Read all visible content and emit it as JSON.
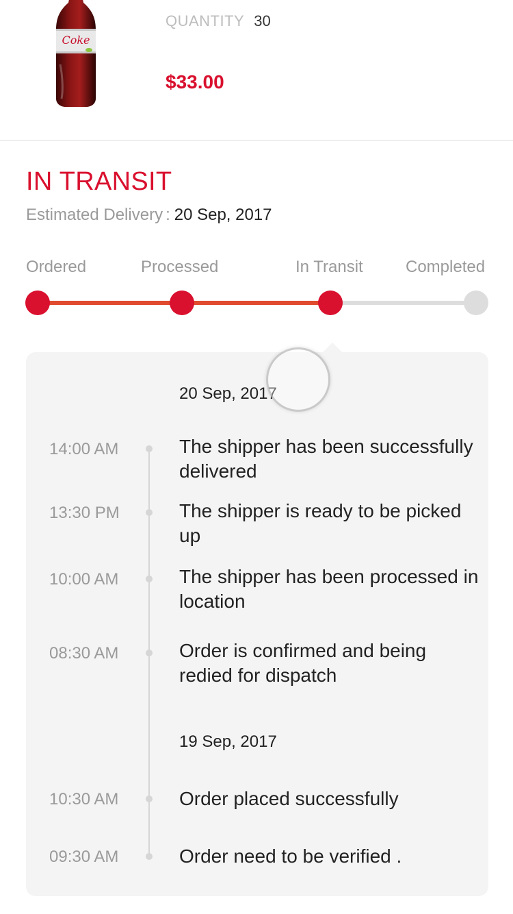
{
  "product": {
    "image_name": "diet-coke-bottle",
    "quantity_label": "QUANTITY",
    "quantity_value": "30",
    "price": "$33.00"
  },
  "status": {
    "title": "IN TRANSIT",
    "estimated_label": "Estimated Delivery",
    "separator": ":",
    "estimated_date": "20 Sep, 2017"
  },
  "progress": {
    "steps": [
      {
        "label": "Ordered",
        "state": "done"
      },
      {
        "label": "Processed",
        "state": "done"
      },
      {
        "label": "In Transit",
        "state": "current"
      },
      {
        "label": "Completed",
        "state": "pending"
      }
    ],
    "colors": {
      "active_dot": "#d9102e",
      "active_line": "#e04a2e",
      "inactive": "#dddddd"
    }
  },
  "timeline": {
    "groups": [
      {
        "date": "20 Sep, 2017",
        "events": [
          {
            "time": "14:00 AM",
            "text": "The shipper has been successfully delivered"
          },
          {
            "time": "13:30 PM",
            "text": "The shipper is ready to be picked up"
          },
          {
            "time": "10:00 AM",
            "text": "The shipper has been processed in location"
          },
          {
            "time": "08:30 AM",
            "text": "Order is confirmed and being redied for dispatch"
          }
        ]
      },
      {
        "date": "19 Sep, 2017",
        "events": [
          {
            "time": "10:30 AM",
            "text": "Order placed successfully"
          },
          {
            "time": "09:30 AM",
            "text": "Order need to be verified ."
          }
        ]
      }
    ]
  },
  "colors": {
    "brand_red": "#d9102e",
    "muted_text": "#9a9a9a",
    "card_bg": "#f4f4f4"
  }
}
